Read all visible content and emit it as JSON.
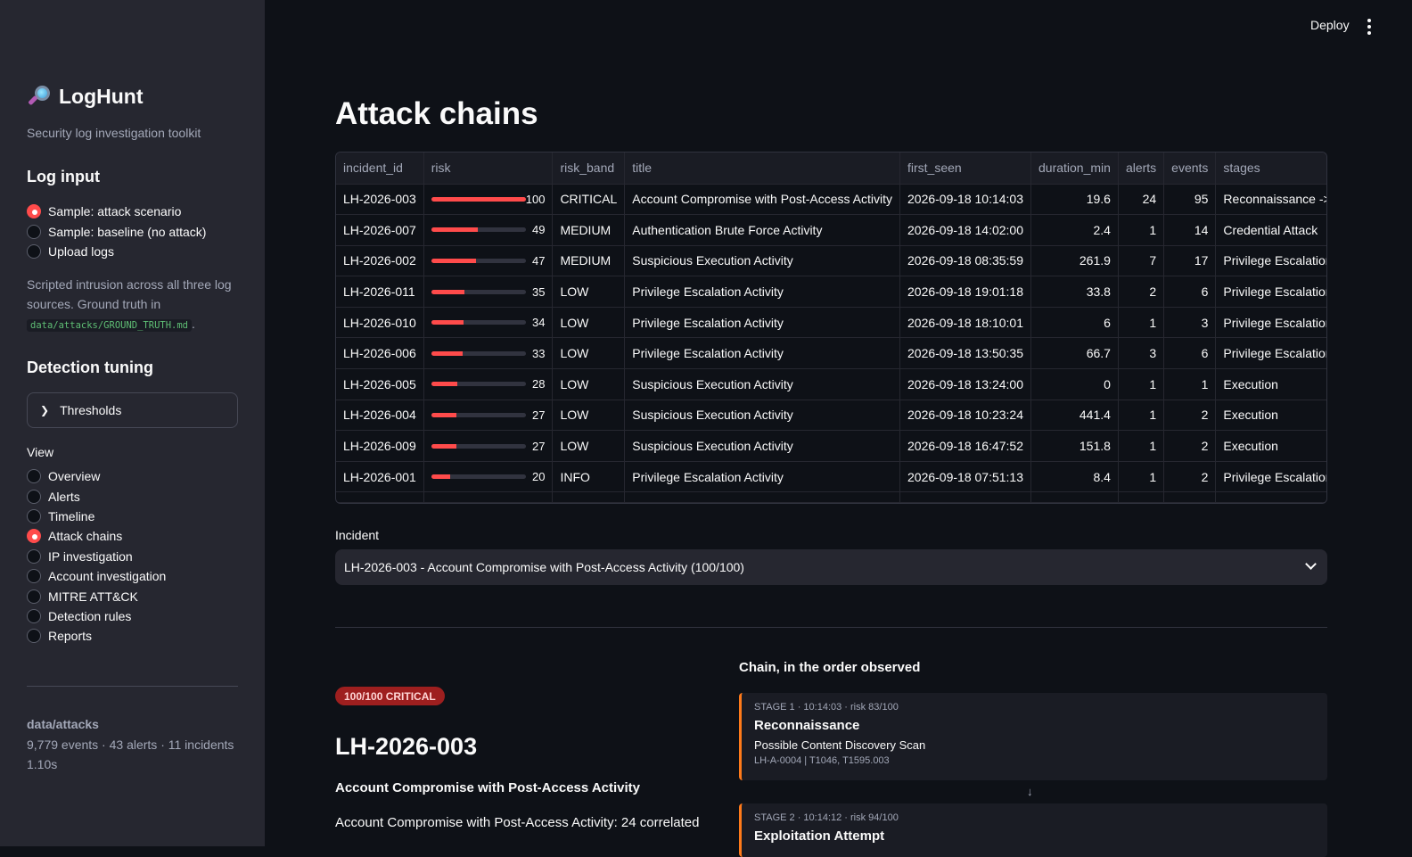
{
  "sidebar": {
    "app_title": "LogHunt",
    "tagline": "Security log investigation toolkit",
    "log_input_title": "Log input",
    "log_input_options": [
      {
        "label": "Sample: attack scenario",
        "selected": true
      },
      {
        "label": "Sample: baseline (no attack)",
        "selected": false
      },
      {
        "label": "Upload logs",
        "selected": false
      }
    ],
    "description_text": "Scripted intrusion across all three log sources. Ground truth in ",
    "description_code": "data/attacks/GROUND_TRUTH.md",
    "description_end": ".",
    "detection_tuning_title": "Detection tuning",
    "thresholds_label": "Thresholds",
    "view_label": "View",
    "view_options": [
      {
        "label": "Overview",
        "selected": false
      },
      {
        "label": "Alerts",
        "selected": false
      },
      {
        "label": "Timeline",
        "selected": false
      },
      {
        "label": "Attack chains",
        "selected": true
      },
      {
        "label": "IP investigation",
        "selected": false
      },
      {
        "label": "Account investigation",
        "selected": false
      },
      {
        "label": "MITRE ATT&CK",
        "selected": false
      },
      {
        "label": "Detection rules",
        "selected": false
      },
      {
        "label": "Reports",
        "selected": false
      }
    ],
    "footer_source": "data/attacks",
    "footer_stats": "9,779 events · 43 alerts · 11 incidents",
    "footer_time": "1.10s"
  },
  "header": {
    "deploy_label": "Deploy"
  },
  "main": {
    "title": "Attack chains",
    "table": {
      "columns": [
        "incident_id",
        "risk",
        "risk_band",
        "title",
        "first_seen",
        "duration_min",
        "alerts",
        "events",
        "stages"
      ],
      "rows": [
        {
          "incident_id": "LH-2026-003",
          "risk": 100,
          "risk_band": "CRITICAL",
          "title": "Account Compromise with Post-Access Activity",
          "first_seen": "2026-09-18 10:14:03",
          "duration_min": "19.6",
          "alerts": "24",
          "events": "95",
          "stages": "Reconnaissance -> Exploitation"
        },
        {
          "incident_id": "LH-2026-007",
          "risk": 49,
          "risk_band": "MEDIUM",
          "title": "Authentication Brute Force Activity",
          "first_seen": "2026-09-18 14:02:00",
          "duration_min": "2.4",
          "alerts": "1",
          "events": "14",
          "stages": "Credential Attack"
        },
        {
          "incident_id": "LH-2026-002",
          "risk": 47,
          "risk_band": "MEDIUM",
          "title": "Suspicious Execution Activity",
          "first_seen": "2026-09-18 08:35:59",
          "duration_min": "261.9",
          "alerts": "7",
          "events": "17",
          "stages": "Privilege Escalation -> Execution"
        },
        {
          "incident_id": "LH-2026-011",
          "risk": 35,
          "risk_band": "LOW",
          "title": "Privilege Escalation Activity",
          "first_seen": "2026-09-18 19:01:18",
          "duration_min": "33.8",
          "alerts": "2",
          "events": "6",
          "stages": "Privilege Escalation"
        },
        {
          "incident_id": "LH-2026-010",
          "risk": 34,
          "risk_band": "LOW",
          "title": "Privilege Escalation Activity",
          "first_seen": "2026-09-18 18:10:01",
          "duration_min": "6",
          "alerts": "1",
          "events": "3",
          "stages": "Privilege Escalation"
        },
        {
          "incident_id": "LH-2026-006",
          "risk": 33,
          "risk_band": "LOW",
          "title": "Privilege Escalation Activity",
          "first_seen": "2026-09-18 13:50:35",
          "duration_min": "66.7",
          "alerts": "3",
          "events": "6",
          "stages": "Privilege Escalation"
        },
        {
          "incident_id": "LH-2026-005",
          "risk": 28,
          "risk_band": "LOW",
          "title": "Suspicious Execution Activity",
          "first_seen": "2026-09-18 13:24:00",
          "duration_min": "0",
          "alerts": "1",
          "events": "1",
          "stages": "Execution"
        },
        {
          "incident_id": "LH-2026-004",
          "risk": 27,
          "risk_band": "LOW",
          "title": "Suspicious Execution Activity",
          "first_seen": "2026-09-18 10:23:24",
          "duration_min": "441.4",
          "alerts": "1",
          "events": "2",
          "stages": "Execution"
        },
        {
          "incident_id": "LH-2026-009",
          "risk": 27,
          "risk_band": "LOW",
          "title": "Suspicious Execution Activity",
          "first_seen": "2026-09-18 16:47:52",
          "duration_min": "151.8",
          "alerts": "1",
          "events": "2",
          "stages": "Execution"
        },
        {
          "incident_id": "LH-2026-001",
          "risk": 20,
          "risk_band": "INFO",
          "title": "Privilege Escalation Activity",
          "first_seen": "2026-09-18 07:51:13",
          "duration_min": "8.4",
          "alerts": "1",
          "events": "2",
          "stages": "Privilege Escalation"
        }
      ]
    },
    "incident_label": "Incident",
    "incident_selected": "LH-2026-003 - Account Compromise with Post-Access Activity (100/100)",
    "detail": {
      "badge": "100/100 CRITICAL",
      "incident_id": "LH-2026-003",
      "title": "Account Compromise with Post-Access Activity",
      "description": "Account Compromise with Post-Access Activity: 24 correlated"
    },
    "chain": {
      "heading": "Chain, in the order observed",
      "stages": [
        {
          "meta": "STAGE 1 · 10:14:03 · risk 83/100",
          "name": "Reconnaissance",
          "alert": "Possible Content Discovery Scan",
          "ids": "LH-A-0004 | T1046, T1595.003"
        },
        {
          "meta": "STAGE 2 · 10:14:12 · risk 94/100",
          "name": "Exploitation Attempt"
        }
      ]
    }
  },
  "colors": {
    "accent": "#ff4b4b",
    "sidebar_bg": "#262730",
    "main_bg": "#0e1117",
    "badge_bg": "#9e1f1f",
    "stage_border": "#ff7a1a"
  }
}
